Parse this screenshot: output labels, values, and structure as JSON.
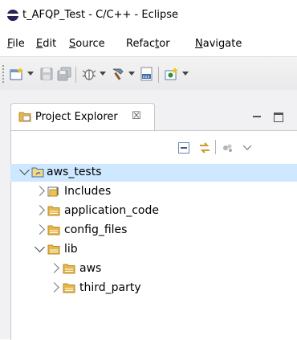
{
  "window": {
    "title": "t_AFQP_Test - C/C++ - Eclipse"
  },
  "menu": {
    "items": [
      {
        "label": "File",
        "mnemonic": "F",
        "rest": "ile"
      },
      {
        "label": "Edit",
        "mnemonic": "E",
        "rest": "dit"
      },
      {
        "label": "Source",
        "mnemonic": "S",
        "rest": "ource"
      },
      {
        "label": "Refactor",
        "pre": "Refac",
        "mnemonic": "t",
        "rest": "or"
      },
      {
        "label": "Navigate",
        "mnemonic": "N",
        "rest": "avigate"
      }
    ]
  },
  "toolbar": {
    "icons": [
      "new-icon",
      "save-icon",
      "save-all-icon",
      "debug-icon",
      "build-icon",
      "binary-icon",
      "new-class-icon"
    ]
  },
  "project_explorer": {
    "tab_label": "Project Explorer",
    "close_glyph": "☒",
    "tree": [
      {
        "label": "aws_tests",
        "expanded": true,
        "level": 0,
        "icon": "project-icon",
        "selected": true
      },
      {
        "label": "Includes",
        "expanded": false,
        "level": 1,
        "icon": "includes-icon"
      },
      {
        "label": "application_code",
        "expanded": false,
        "level": 1,
        "icon": "folder-icon"
      },
      {
        "label": "config_files",
        "expanded": false,
        "level": 1,
        "icon": "folder-icon"
      },
      {
        "label": "lib",
        "expanded": true,
        "level": 1,
        "icon": "folder-icon"
      },
      {
        "label": "aws",
        "expanded": false,
        "level": 2,
        "icon": "folder-icon"
      },
      {
        "label": "third_party",
        "expanded": false,
        "level": 2,
        "icon": "folder-icon"
      }
    ]
  },
  "colors": {
    "selection": "#cde8ff",
    "folder": "#e6b84a",
    "accent": "#2c2255"
  }
}
